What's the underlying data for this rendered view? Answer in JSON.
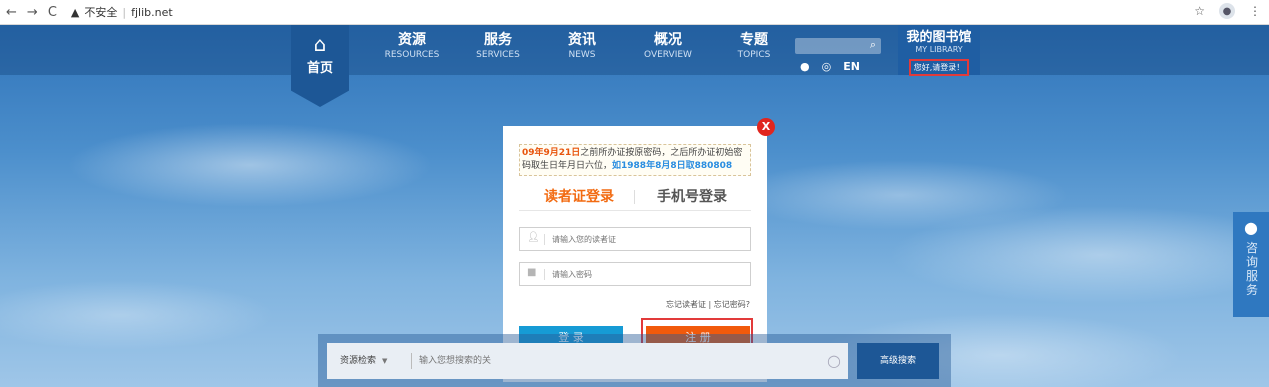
{
  "browser": {
    "security_label": "不安全",
    "url": "fjlib.net"
  },
  "nav": {
    "home_label": "首页",
    "items": [
      {
        "zh": "资源",
        "en": "RESOURCES"
      },
      {
        "zh": "服务",
        "en": "SERVICES"
      },
      {
        "zh": "资讯",
        "en": "NEWS"
      },
      {
        "zh": "概况",
        "en": "OVERVIEW"
      },
      {
        "zh": "专题",
        "en": "TOPICS"
      }
    ],
    "lang_label": "EN",
    "my_library": {
      "zh": "我的图书馆",
      "en": "MY LIBRARY",
      "login_prompt": "您好,请登录！"
    }
  },
  "modal": {
    "close_label": "X",
    "notice": {
      "date": "09年9月21日",
      "text1": "之前所办证按原密码，之后所办证初始密码取生日年月日六位，",
      "example": "如1988年8月8日取880808"
    },
    "tabs": {
      "reader_card": "读者证登录",
      "phone": "手机号登录"
    },
    "card_placeholder": "请输入您的读者证",
    "password_placeholder": "请输入密码",
    "forgot_card": "忘记读者证",
    "forgot_sep": "|",
    "forgot_password": "忘记密码?",
    "login_button": "登 录",
    "register_button": "注 册"
  },
  "search": {
    "scope": "资源检索",
    "placeholder": "输入您想搜索的关",
    "advanced_button": "高级搜索"
  },
  "consult": {
    "label": "咨询服务"
  },
  "colors": {
    "accent_orange": "#f15a0c",
    "accent_blue": "#169bd5",
    "highlight_red": "#e23a3a",
    "nav_blue": "#1d5796"
  }
}
